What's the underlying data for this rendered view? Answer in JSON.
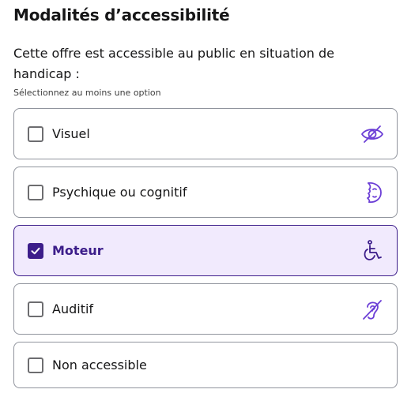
{
  "section": {
    "title": "Modalités d’accessibilité",
    "description": "Cette offre est accessible au public en situation de handicap :",
    "hint": "Sélectionnez au moins une option"
  },
  "options": [
    {
      "label": "Visuel",
      "checked": false,
      "icon": "eye-crossed-icon"
    },
    {
      "label": "Psychique ou cognitif",
      "checked": false,
      "icon": "face-profile-icon"
    },
    {
      "label": "Moteur",
      "checked": true,
      "icon": "wheelchair-icon"
    },
    {
      "label": "Auditif",
      "checked": false,
      "icon": "ear-crossed-icon"
    },
    {
      "label": "Non accessible",
      "checked": false,
      "icon": ""
    }
  ],
  "colors": {
    "accent": "#3c1d8a",
    "selected_background": "#f1eafd",
    "icon": "#6c3fd6",
    "border": "#90949d"
  }
}
